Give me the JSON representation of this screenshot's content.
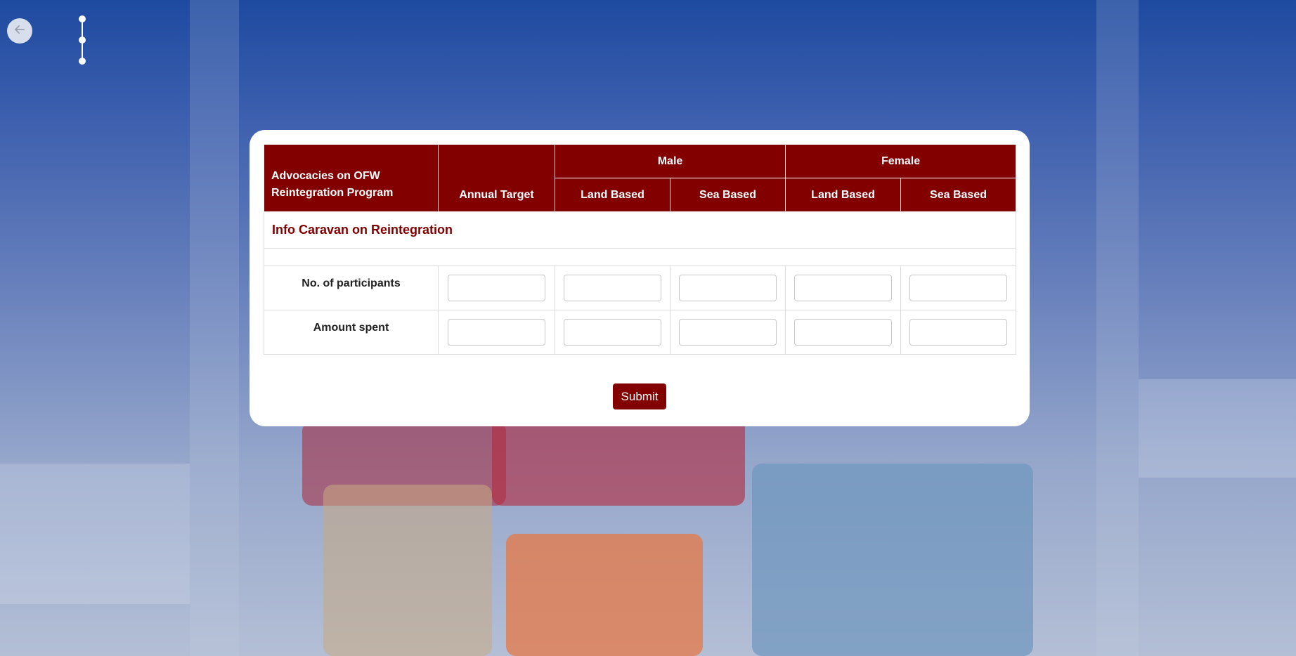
{
  "nav": {
    "back_icon": "arrow-left-icon",
    "stepper_icon": "vertical-stepper-icon"
  },
  "table": {
    "header": {
      "program_label": "Advocacies on OFW Reintegration Program",
      "annual_target": "Annual Target",
      "male": "Male",
      "female": "Female",
      "male_land": "Land Based",
      "male_sea": "Sea Based",
      "female_land": "Land Based",
      "female_sea": "Sea Based"
    },
    "section_title": "Info Caravan on Reintegration",
    "rows": [
      {
        "label": "No. of participants",
        "values": [
          "",
          "",
          "",
          "",
          ""
        ]
      },
      {
        "label": "Amount spent",
        "values": [
          "",
          "",
          "",
          "",
          ""
        ]
      }
    ]
  },
  "actions": {
    "submit_label": "Submit"
  },
  "colors": {
    "accent": "#820000",
    "card": "#ffffff"
  }
}
